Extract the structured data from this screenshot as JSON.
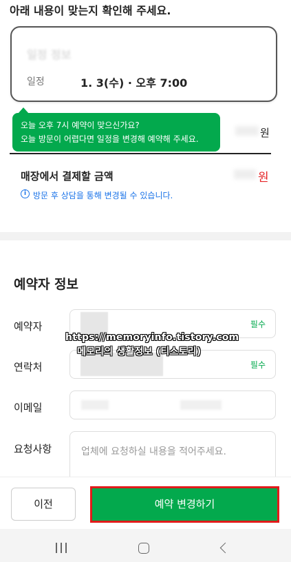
{
  "header": {
    "confirm_text": "아래 내용이 맞는지 확인해 주세요."
  },
  "schedule_card": {
    "title": "일정 정보",
    "row_label": "일정",
    "row_value": "1. 3(수) · 오후 7:00"
  },
  "tooltip": {
    "line1": "오늘 오후 7시 예약이 맞으신가요?",
    "line2": "오늘 방문이 어렵다면 일정을 변경해 예약해 주세요."
  },
  "summary": {
    "currency_unit": "원",
    "pay_label": "매장에서 결제할 금액",
    "pay_unit": "원",
    "info_icon_glyph": "i",
    "info_note": "방문 후 상담을 통해 변경될 수 있습니다."
  },
  "booker": {
    "section_title": "예약자 정보",
    "name_label": "예약자",
    "phone_label": "연락처",
    "email_label": "이메일",
    "request_label": "요청사항",
    "required_badge": "필수",
    "request_placeholder": "업체에 요청하실 내용을 적어주세요."
  },
  "watermark": {
    "url": "https://memoryinfo.tistory.com",
    "name": "메모리의 생활정보 (티스토리)"
  },
  "footer": {
    "prev_label": "이전",
    "submit_label": "예약 변경하기"
  },
  "colors": {
    "accent_green": "#03a94d",
    "price_red": "#e52528",
    "info_blue": "#1a73e8",
    "highlight_red_border": "#e11b1b"
  },
  "icons": {
    "info": "info-circle-icon",
    "nav_recents": "recent-apps-icon",
    "nav_home": "home-icon",
    "nav_back": "back-icon"
  }
}
